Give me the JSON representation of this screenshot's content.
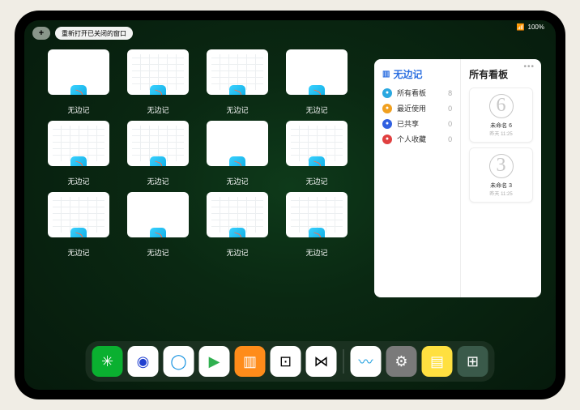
{
  "statusbar": {
    "wifi": "📶",
    "battery": "100%"
  },
  "topbar": {
    "plus": "+",
    "reopen_label": "重新打开已关闭的窗口"
  },
  "app_name": "无边记",
  "windows": [
    {
      "label": "无边记",
      "variant": "blank"
    },
    {
      "label": "无边记",
      "variant": "grid"
    },
    {
      "label": "无边记",
      "variant": "grid"
    },
    {
      "label": "无边记",
      "variant": "blank"
    },
    {
      "label": "无边记",
      "variant": "grid"
    },
    {
      "label": "无边记",
      "variant": "grid"
    },
    {
      "label": "无边记",
      "variant": "blank"
    },
    {
      "label": "无边记",
      "variant": "grid"
    },
    {
      "label": "无边记",
      "variant": "grid"
    },
    {
      "label": "无边记",
      "variant": "blank"
    },
    {
      "label": "无边记",
      "variant": "grid"
    },
    {
      "label": "无边记",
      "variant": "grid"
    }
  ],
  "sidepanel": {
    "left_title": "无边记",
    "right_title": "所有看板",
    "nav": [
      {
        "icon_color": "#2aa8e0",
        "label": "所有看板",
        "count": "8"
      },
      {
        "icon_color": "#f0a020",
        "label": "最近使用",
        "count": "0"
      },
      {
        "icon_color": "#3060e0",
        "label": "已共享",
        "count": "0"
      },
      {
        "icon_color": "#e04040",
        "label": "个人收藏",
        "count": "0"
      }
    ],
    "boards": [
      {
        "sketch": "6",
        "name": "未命名 6",
        "time": "昨天 11:25"
      },
      {
        "sketch": "3",
        "name": "未命名 3",
        "time": "昨天 11:25"
      }
    ]
  },
  "dock": [
    {
      "name": "wechat",
      "bg": "#0ab030",
      "glyph": "✳"
    },
    {
      "name": "quark",
      "bg": "#ffffff",
      "glyph": "◉",
      "fg": "#2040d0"
    },
    {
      "name": "qqbrowser",
      "bg": "#ffffff",
      "glyph": "◯",
      "fg": "#1090e0"
    },
    {
      "name": "play",
      "bg": "#ffffff",
      "glyph": "▶",
      "fg": "#30b050"
    },
    {
      "name": "books",
      "bg": "#ff8c1a",
      "glyph": "▥"
    },
    {
      "name": "dice",
      "bg": "#ffffff",
      "glyph": "⊡",
      "fg": "#000"
    },
    {
      "name": "connect",
      "bg": "#ffffff",
      "glyph": "⋈",
      "fg": "#000"
    },
    {
      "name": "freeform",
      "bg": "#ffffff",
      "glyph": "〰",
      "fg": "#20a0e0"
    },
    {
      "name": "settings",
      "bg": "#7a7a7a",
      "glyph": "⚙"
    },
    {
      "name": "notes",
      "bg": "#ffe040",
      "glyph": "▤",
      "fg": "#fff"
    },
    {
      "name": "recent-group",
      "bg": "#3a5a4a",
      "glyph": "⊞"
    }
  ]
}
